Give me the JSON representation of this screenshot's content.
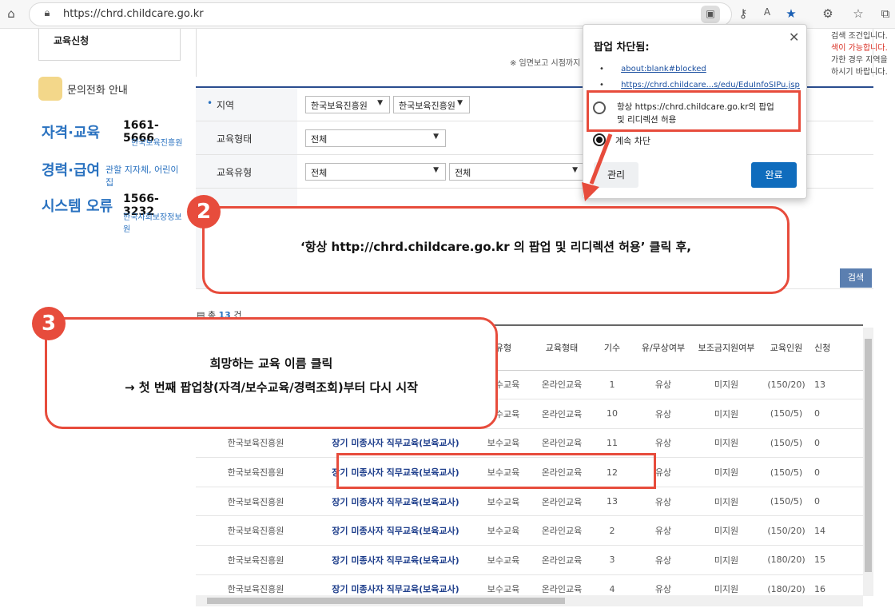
{
  "browser": {
    "url": "https://chrd.childcare.go.kr",
    "icons": [
      "home-icon",
      "site-info-icon",
      "popup-blocked-icon",
      "key-icon",
      "read-aloud-icon",
      "favorite-star-icon",
      "extensions-icon",
      "favorites-icon",
      "collections-icon"
    ]
  },
  "sidebar": {
    "tab_label": "교육신청",
    "contact_title": "문의전화 안내",
    "contacts": [
      {
        "label": "자격·교육",
        "phone": "1661-5666",
        "org": "한국보육진흥원"
      },
      {
        "label": "경력·급여",
        "phone": "",
        "org": "관할 지자체, 어린이집"
      },
      {
        "label": "시스템 오류",
        "phone": "1566-3232",
        "org": "한국사회보장정보원"
      }
    ]
  },
  "notice": {
    "left_text": "※ 임면보고 시점까지",
    "right_lines": [
      "검색 조건입니다.",
      "색이 가능합니다.",
      "가한 경우 지역을",
      "하시기 바랍니다."
    ]
  },
  "form": {
    "region_label": "지역",
    "region_select1": "한국보육진흥원",
    "region_select2": "한국보육진흥원",
    "type_label": "교육형태",
    "type_select": "전체",
    "category_label": "교육유형",
    "category_select1": "전체",
    "category_select2": "전체",
    "search_button": "검색"
  },
  "results": {
    "total_prefix": "총",
    "total_count": "13",
    "total_suffix": "건",
    "headers": [
      "유형",
      "교육형태",
      "기수",
      "유/무상여부",
      "보조금지원여부",
      "교육인원",
      "신청"
    ],
    "rows": [
      {
        "org": "",
        "course": "",
        "type": "보수교육",
        "form": "온라인교육",
        "term": "1",
        "paid": "유상",
        "subsidy": "미지원",
        "capacity": "(150/20)",
        "apply": "13"
      },
      {
        "org": "",
        "course": "",
        "type": "보수교육",
        "form": "온라인교육",
        "term": "10",
        "paid": "유상",
        "subsidy": "미지원",
        "capacity": "(150/5)",
        "apply": "0"
      },
      {
        "org": "한국보육진흥원",
        "course": "장기 미종사자 직무교육(보육교사)",
        "type": "보수교육",
        "form": "온라인교육",
        "term": "11",
        "paid": "유상",
        "subsidy": "미지원",
        "capacity": "(150/5)",
        "apply": "0"
      },
      {
        "org": "한국보육진흥원",
        "course": "장기 미종사자 직무교육(보육교사)",
        "type": "보수교육",
        "form": "온라인교육",
        "term": "12",
        "paid": "유상",
        "subsidy": "미지원",
        "capacity": "(150/5)",
        "apply": "0"
      },
      {
        "org": "한국보육진흥원",
        "course": "장기 미종사자 직무교육(보육교사)",
        "type": "보수교육",
        "form": "온라인교육",
        "term": "13",
        "paid": "유상",
        "subsidy": "미지원",
        "capacity": "(150/5)",
        "apply": "0"
      },
      {
        "org": "한국보육진흥원",
        "course": "장기 미종사자 직무교육(보육교사)",
        "type": "보수교육",
        "form": "온라인교육",
        "term": "2",
        "paid": "유상",
        "subsidy": "미지원",
        "capacity": "(150/20)",
        "apply": "14"
      },
      {
        "org": "한국보육진흥원",
        "course": "장기 미종사자 직무교육(보육교사)",
        "type": "보수교육",
        "form": "온라인교육",
        "term": "3",
        "paid": "유상",
        "subsidy": "미지원",
        "capacity": "(180/20)",
        "apply": "15"
      },
      {
        "org": "한국보육진흥원",
        "course": "장기 미종사자 직무교육(보육교사)",
        "type": "보수교육",
        "form": "온라인교육",
        "term": "4",
        "paid": "유상",
        "subsidy": "미지원",
        "capacity": "(180/20)",
        "apply": "16"
      }
    ]
  },
  "popup": {
    "title": "팝업 차단됨:",
    "links": [
      "about:blank#blocked",
      "https://chrd.childcare...s/edu/EduInfoSIPu.jsp"
    ],
    "option_allow": "항상 https://chrd.childcare.go.kr의 팝업 및 리디렉션 허용",
    "option_block": "계속 차단",
    "manage_button": "관리",
    "done_button": "완료"
  },
  "annotations": {
    "step2_number": "2",
    "step2_text": "‘항상 http://chrd.childcare.go.kr 의 팝업 및 리디렉션 허용’ 클릭 후,",
    "step3_number": "3",
    "step3_line1": "희망하는 교육 이름 클릭",
    "step3_line2": "→ 첫 번째 팝업창(자격/보수교육/경력조회)부터 다시 시작",
    "accent_color": "#e74c3c"
  }
}
